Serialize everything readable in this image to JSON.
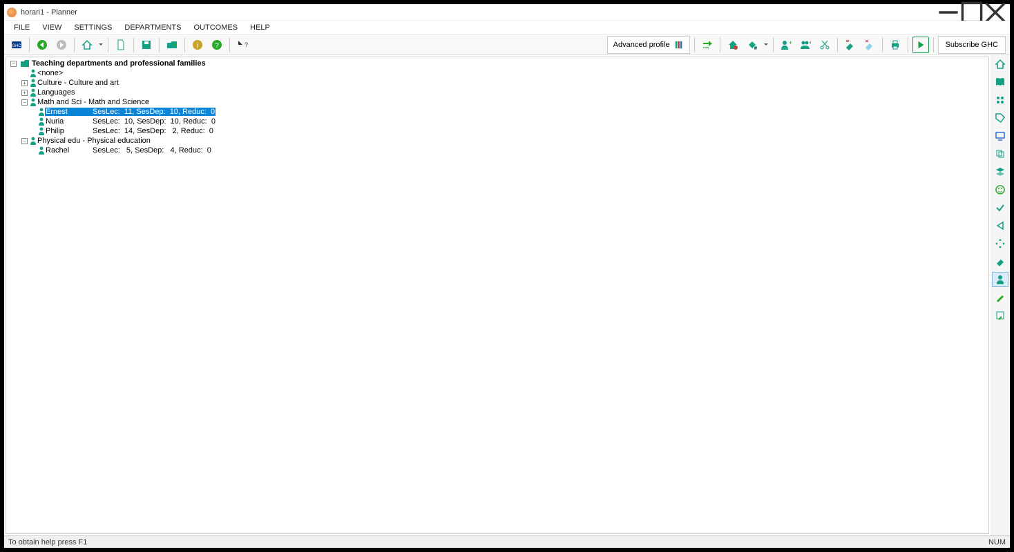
{
  "title": "horari1 - Planner",
  "menu": [
    "FILE",
    "VIEW",
    "SETTINGS",
    "DEPARTMENTS",
    "OUTCOMES",
    "HELP"
  ],
  "toolbar_right": {
    "advanced_profile": "Advanced profile",
    "subscribe": "Subscribe GHC"
  },
  "tree": {
    "root": "Teaching departments and professional families",
    "none": "<none>",
    "culture": "Culture - Culture and art",
    "languages": "Languages",
    "mathsci": "Math and Sci - Math and Science",
    "physed": "Physical edu - Physical education",
    "teachers": {
      "ernest": {
        "name": "Ernest",
        "stats": "SesLec:  11, SesDep:  10, Reduc:  0"
      },
      "nuria": {
        "name": "Nuria",
        "stats": "SesLec:  10, SesDep:  10, Reduc:  0"
      },
      "philip": {
        "name": "Philip",
        "stats": "SesLec:  14, SesDep:   2, Reduc:  0"
      },
      "rachel": {
        "name": "Rachel",
        "stats": "SesLec:   5, SesDep:   4, Reduc:  0"
      }
    }
  },
  "status": {
    "left": "To obtain help press F1",
    "right": "NUM"
  }
}
